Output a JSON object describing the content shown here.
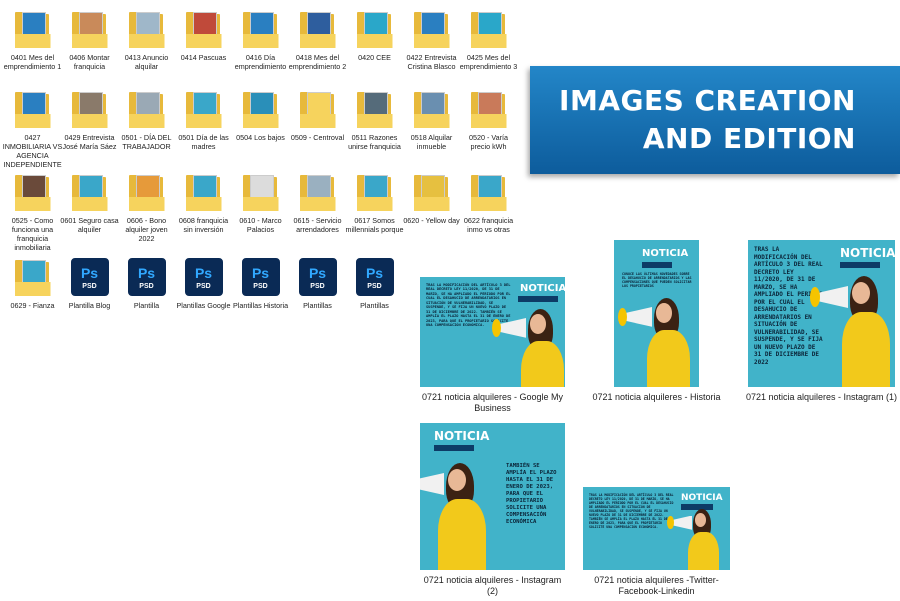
{
  "folders": [
    {
      "label": "0401 Mes del emprendimiento 1",
      "type": "folder",
      "accent": "#2a7fc1"
    },
    {
      "label": "0406 Montar franquicia",
      "type": "folder",
      "accent": "#c98a5a"
    },
    {
      "label": "0413 Anuncio alquilar",
      "type": "folder",
      "accent": "#9fb7c9"
    },
    {
      "label": "0414 Pascuas",
      "type": "folder",
      "accent": "#c04a3a"
    },
    {
      "label": "0416 Día emprendimiento",
      "type": "folder",
      "accent": "#2a7fc1"
    },
    {
      "label": "0418 Mes del emprendimiento 2",
      "type": "folder",
      "accent": "#2e5e9e"
    },
    {
      "label": "0420 CEE",
      "type": "folder",
      "accent": "#2aa7c9"
    },
    {
      "label": "0422 Entrevista Cristina Blasco",
      "type": "folder",
      "accent": "#2a7fc1"
    },
    {
      "label": "0425 Mes del emprendimiento 3",
      "type": "folder",
      "accent": "#2aa7c9"
    },
    {
      "label": "0427 INMOBILIARIA VS AGENCIA INDEPENDIENTE",
      "type": "folder",
      "accent": "#2a7fc1"
    },
    {
      "label": "0429 Entrevista José María Sáez",
      "type": "folder",
      "accent": "#8a7a6a"
    },
    {
      "label": "0501 - DÍA DEL TRABAJADOR",
      "type": "folder",
      "accent": "#9aa9b5"
    },
    {
      "label": "0501 Día de las madres",
      "type": "folder",
      "accent": "#3aa7c9"
    },
    {
      "label": "0504 Los bajos",
      "type": "folder",
      "accent": "#2a8fb9"
    },
    {
      "label": "0509 - Centroval",
      "type": "folder",
      "accent": "#f6d35d"
    },
    {
      "label": "0511 Razones unirse franquicia",
      "type": "folder",
      "accent": "#556b7a"
    },
    {
      "label": "0518 Alquilar inmueble",
      "type": "folder",
      "accent": "#6a8fb0"
    },
    {
      "label": "0520 - Varía precio kWh",
      "type": "folder",
      "accent": "#c97a5a"
    },
    {
      "label": "0525 - Como funciona una franquicia inmobiliaria",
      "type": "folder",
      "accent": "#6a4a3a"
    },
    {
      "label": "0601 Seguro casa alquiler",
      "type": "folder",
      "accent": "#3aa7c9"
    },
    {
      "label": "0606 - Bono alquiler joven 2022",
      "type": "folder",
      "accent": "#e69a3a"
    },
    {
      "label": "0608 franquicia sin inversión",
      "type": "folder",
      "accent": "#3aa7c9"
    },
    {
      "label": "0610 - Marco Palacios",
      "type": "folder",
      "accent": "#dcdcdc"
    },
    {
      "label": "0615 - Servicio arrendadores",
      "type": "folder",
      "accent": "#9ab0c0"
    },
    {
      "label": "0617 Somos millennials porque",
      "type": "folder",
      "accent": "#3aa7c9"
    },
    {
      "label": "0620 - Yellow day",
      "type": "folder",
      "accent": "#e6c040"
    },
    {
      "label": "0622 franquicia inmo vs otras",
      "type": "folder",
      "accent": "#3aa7c9"
    },
    {
      "label": "0629 - Fianza",
      "type": "folder",
      "accent": "#3aa7c9"
    },
    {
      "label": "Plantilla Blog",
      "type": "psd"
    },
    {
      "label": "Plantilla",
      "type": "psd"
    },
    {
      "label": "Plantillas Google",
      "type": "psd"
    },
    {
      "label": "Plantillas Historia",
      "type": "psd"
    },
    {
      "label": "Plantillas",
      "type": "psd"
    },
    {
      "label": "Plantillas",
      "type": "psd"
    }
  ],
  "psd_icon": {
    "glyph": "Ps",
    "ext": "PSD"
  },
  "banner": {
    "line1": "IMAGES CREATION",
    "line2": "AND EDITION"
  },
  "images": [
    {
      "caption": "0721 noticia alquileres - Google My Business",
      "heading": "NOTICIA",
      "body": "TRAS LA MODIFICACIÓN DEL ARTÍCULO 3 DEL REAL DECRETO LEY 11/2020, DE 31 DE MARZO, SE HA AMPLIADO EL PERIODO POR EL CUAL EL DESAHUCIO DE ARRENDATARIOS EN SITUACIÓN DE VULNERABILIDAD, SE SUSPENDE, Y SE FIJA UN NUEVO PLAZO DE 31 DE DICIEMBRE DE 2022. TAMBIÉN SE AMPLÍA EL PLAZO HASTA EL 31 DE ENERO DE 2023, PARA QUE EL PROPIETARIO SOLICITE UNA COMPENSACIÓN ECONÓMICA."
    },
    {
      "caption": "0721 noticia alquileres - Historia",
      "heading": "NOTICIA",
      "body": "CONOCE LAS ÚLTIMAS NOVEDADES SOBRE EL DESAHUCIO DE ARRENDATARIOS Y LAS COMPENSACIONES QUE PUEDEN SOLICITAR LOS PROPIETARIOS"
    },
    {
      "caption": "0721 noticia alquileres - Instagram (1)",
      "heading": "NOTICIA",
      "body": "TRAS LA MODIFICACIÓN DEL ARTÍCULO 3 DEL REAL DECRETO LEY 11/2020, DE 31 DE MARZO, SE HA AMPLIADO EL PERIODO POR EL CUAL EL DESAHUCIO DE ARRENDATARIOS EN SITUACIÓN DE VULNERABILIDAD, SE SUSPENDE, Y SE FIJA UN NUEVO PLAZO DE 31 DE DICIEMBRE DE 2022"
    },
    {
      "caption": "0721 noticia alquileres - Instagram (2)",
      "heading": "NOTICIA",
      "body": "TAMBIÉN SE AMPLÍA EL PLAZO HASTA EL 31 DE ENERO DE 2023, PARA QUE EL PROPIETARIO SOLICITE UNA COMPENSACIÓN ECONÓMICA"
    },
    {
      "caption": "0721 noticia alquileres -Twitter-Facebook-Linkedin",
      "heading": "NOTICIA",
      "body": "TRAS LA MODIFICACIÓN DEL ARTÍCULO 3 DEL REAL DECRETO LEY 11/2020, DE 31 DE MARZO, SE HA AMPLIADO EL PERIODO POR EL CUAL EL DESAHUCIO DE ARRENDATARIOS EN SITUACIÓN DE VULNERABILIDAD, SE SUSPENDE, Y SE FIJA UN NUEVO PLAZO DE 31 DE DICIEMBRE DE 2022. TAMBIÉN SE AMPLÍA EL PLAZO HASTA EL 31 DE ENERO DE 2023, PARA QUE EL PROPIETARIO SOLICITE UNA COMPENSACIÓN ECONÓMICA."
    }
  ],
  "colors": {
    "card_bg": "#41b3c9",
    "banner": "#1572b6",
    "folder": "#e7b93b",
    "psd": "#0a2a55"
  }
}
